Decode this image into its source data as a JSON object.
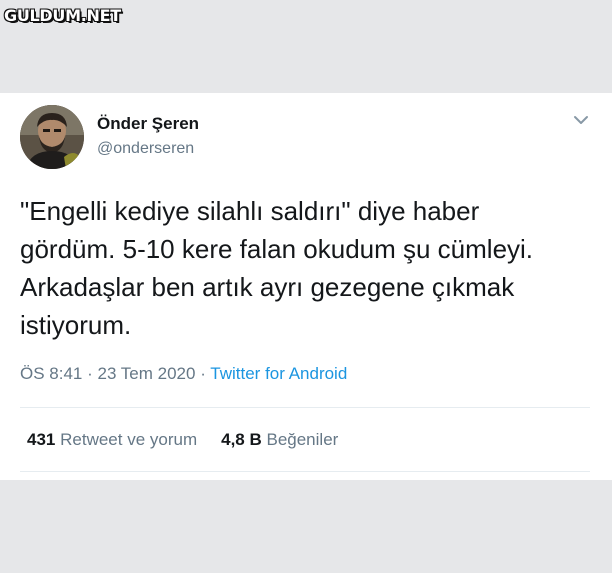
{
  "watermark": "GULDUM.NET",
  "tweet": {
    "display_name": "Önder Şeren",
    "handle": "@onderseren",
    "text": "\"Engelli kediye silahlı saldırı\" diye haber gördüm. 5-10 kere falan okudum şu cümleyi. Arkadaşlar ben artık ayrı gezegene çıkmak istiyorum.",
    "time": "ÖS 8:41",
    "separator": " · ",
    "date": "23 Tem 2020",
    "source": "Twitter for Android"
  },
  "stats": {
    "retweets_count": "431",
    "retweets_label": "Retweet ve yorum",
    "likes_count": "4,8 B",
    "likes_label": "Beğeniler"
  },
  "icons": {
    "menu": "chevron-down-icon",
    "avatar": "user-avatar-photo"
  },
  "colors": {
    "background": "#e6e7e9",
    "card": "#ffffff",
    "text": "#14171a",
    "secondary": "#657786",
    "link": "#1b95e0",
    "divider": "#e6ecf0"
  }
}
